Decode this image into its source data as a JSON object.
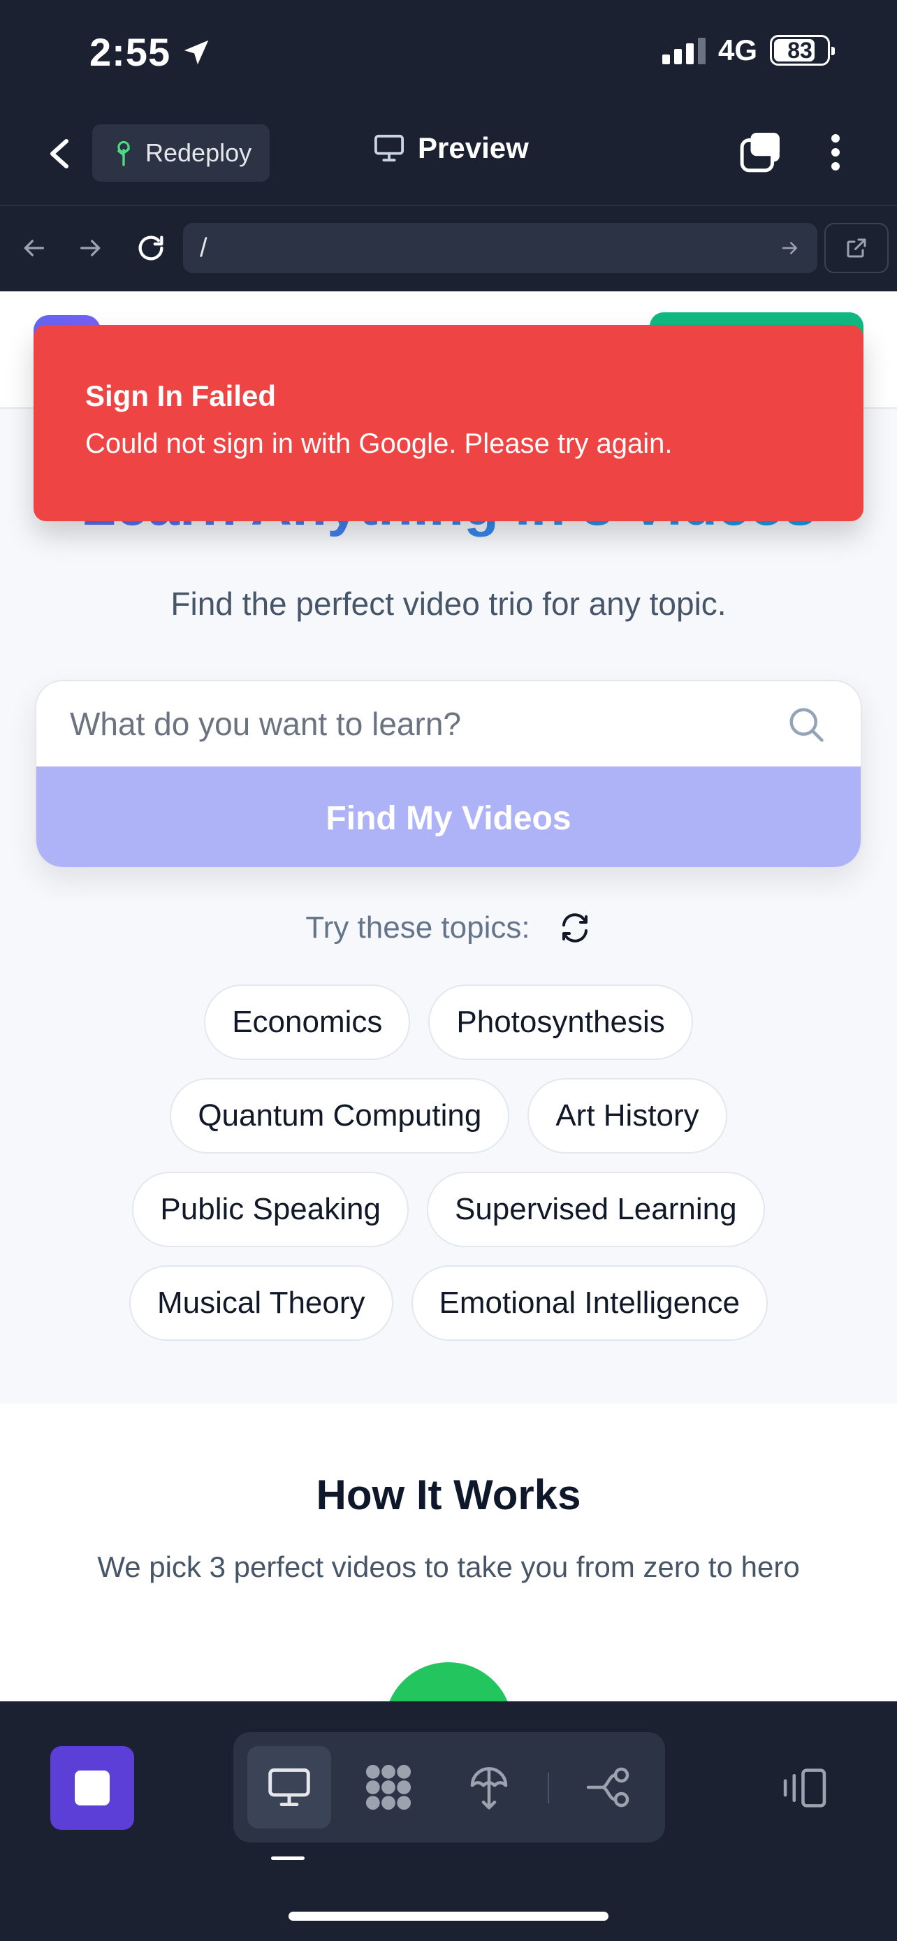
{
  "status_bar": {
    "time": "2:55",
    "network": "4G",
    "battery": "83",
    "icons": [
      "location-arrow-icon",
      "signal-bars-icon",
      "battery-icon"
    ]
  },
  "header": {
    "back_icon": "chevron-left-icon",
    "redeploy_label": "Redeploy",
    "redeploy_icon": "tree-icon",
    "title": "Preview",
    "title_icon": "monitor-icon",
    "tabs_icon": "tabs-icon",
    "more_icon": "more-vertical-icon",
    "accent_color": "#4ade80"
  },
  "url_bar": {
    "back_icon": "arrow-left-icon",
    "forward_icon": "arrow-right-icon",
    "reload_icon": "reload-icon",
    "url": "/",
    "go_icon": "arrow-right-icon",
    "external_icon": "external-link-icon"
  },
  "page": {
    "hero_title": "Learn Anything in 3 Videos",
    "hero_subtitle": "Find the perfect video trio for any topic.",
    "search": {
      "placeholder": "What do you want to learn?",
      "value": "",
      "button_label": "Find My Videos"
    },
    "try_label": "Try these topics:",
    "topics": [
      "Economics",
      "Photosynthesis",
      "Quantum Computing",
      "Art History",
      "Public Speaking",
      "Supervised Learning",
      "Musical Theory",
      "Emotional Intelligence"
    ],
    "how": {
      "title": "How It Works",
      "subtitle": "We pick 3 perfect videos to take you from zero to hero"
    }
  },
  "toast": {
    "title": "Sign In Failed",
    "message": "Could not sign in with Google. Please try again.",
    "color": "#ef4444"
  },
  "bottom_bar": {
    "stop_icon": "stop-icon",
    "segments": [
      "monitor-icon",
      "apps-grid-icon",
      "deploy-icon",
      "workflow-icon"
    ],
    "active_segment": "monitor-icon",
    "panel_icon": "panel-toggle-icon",
    "stop_color": "#5b3fd6"
  }
}
